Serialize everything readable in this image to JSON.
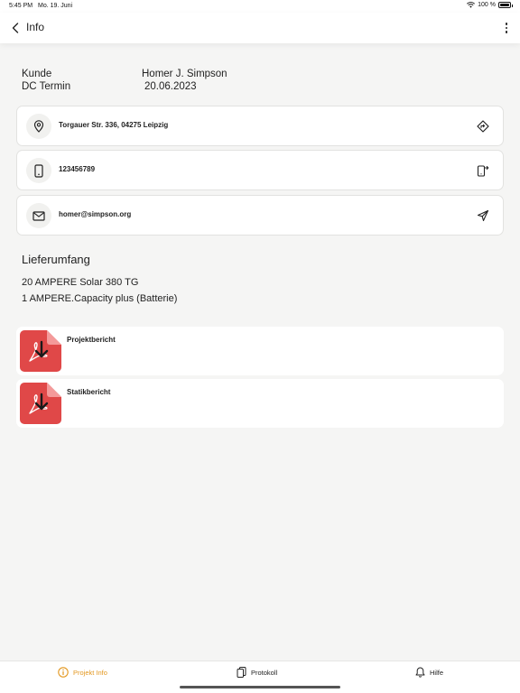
{
  "status_bar": {
    "time": "5:45 PM",
    "date": "Mo. 19. Juni",
    "battery": "100 %"
  },
  "nav": {
    "title": "Info"
  },
  "info": {
    "customer_label": "Kunde",
    "customer_value": "Homer J. Simpson",
    "appointment_label": "DC Termin",
    "appointment_value": "20.06.2023"
  },
  "contacts": {
    "address": "Torgauer Str. 336, 04275 Leipzig",
    "phone": "123456789",
    "email": "homer@simpson.org"
  },
  "scope": {
    "title": "Lieferumfang",
    "items": [
      "20 AMPERE Solar 380 TG",
      "1 AMPERE.Capacity plus (Batterie)"
    ]
  },
  "documents": [
    {
      "label": "Projektbericht",
      "icon": "pdf-download-icon"
    },
    {
      "label": "Statikbericht",
      "icon": "pdf-download-icon"
    }
  ],
  "tabs": [
    {
      "label": "Projekt Info",
      "icon": "info-icon",
      "active": true
    },
    {
      "label": "Protokoll",
      "icon": "documents-icon",
      "active": false
    },
    {
      "label": "Hilfe",
      "icon": "bell-icon",
      "active": false
    }
  ],
  "colors": {
    "accent": "#e3971f",
    "pdf_red": "#e04848",
    "background": "#f5f5f4"
  }
}
